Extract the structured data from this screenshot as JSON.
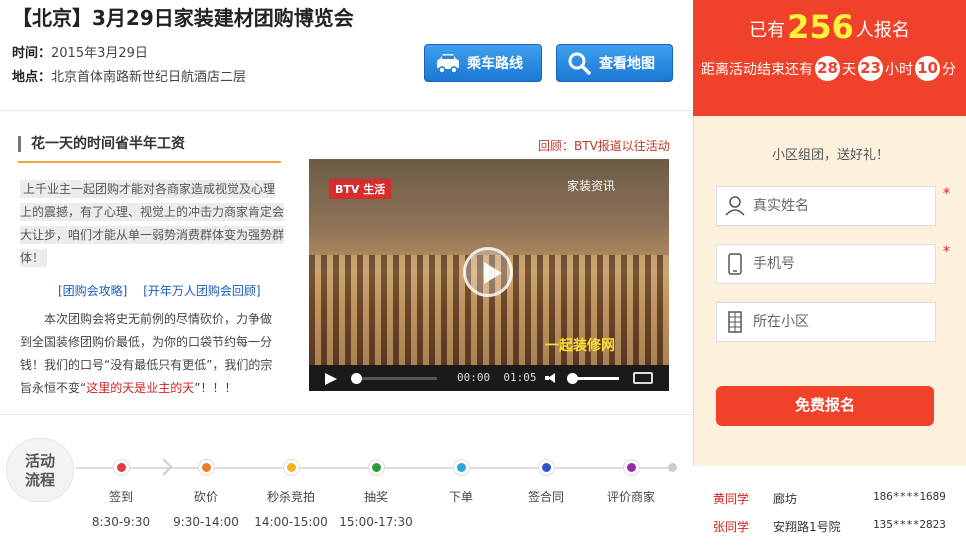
{
  "event": {
    "title": "【北京】3月29日家装建材团购博览会",
    "time_label": "时间：",
    "time_value": "2015年3月29日",
    "addr_label": "地点：",
    "addr_value": "北京首体南路新世纪日航酒店二层"
  },
  "actions": {
    "bus_route": "乘车路线",
    "view_map": "查看地图"
  },
  "intro": {
    "section_title": "花一天的时间省半年工资",
    "review_link": "回顾：BTV报道以往活动",
    "highlight": "上千业主一起团购才能对各商家造成视觉及心理上的震撼，有了心理、视觉上的冲击力商家肯定会大让步，咱们才能从单一弱势消费群体变为强势群体！",
    "link1": "[团购会攻略]",
    "link2": "[开年万人团购会回顾]",
    "body_before": "本次团购会将史无前例的尽情砍价，力争做到全国装修团购价最低，为你的口袋节约每一分钱！我们的口号“没有最低只有更低”，我们的宗旨永恒不变“",
    "body_red": "这里的天是业主的天",
    "body_after": "”！！！"
  },
  "video": {
    "channel_badge": "BTV 生活",
    "channel_text": "家装资讯",
    "banner_text": "一起装修网",
    "time_current": "00:00",
    "time_total": "01:05",
    "progress": 0.0,
    "volume": 1.0
  },
  "process": {
    "badge_line1": "活动",
    "badge_line2": "流程",
    "steps": [
      {
        "name": "签到",
        "time": "8:30-9:30",
        "color": "#e23b3b"
      },
      {
        "name": "砍价",
        "time": "9:30-14:00",
        "color": "#f07c22"
      },
      {
        "name": "秒杀竞拍",
        "time": "14:00-15:00",
        "color": "#f2b51e"
      },
      {
        "name": "抽奖",
        "time": "15:00-17:30",
        "color": "#2a9a3a"
      },
      {
        "name": "下单",
        "time": "",
        "color": "#2aa8d8"
      },
      {
        "name": "签合同",
        "time": "",
        "color": "#2a55c8"
      },
      {
        "name": "评价商家",
        "time": "",
        "color": "#9a2aaa"
      }
    ]
  },
  "registration": {
    "count_prefix": "已有",
    "count": "256",
    "count_suffix": "人报名",
    "countdown_prefix": "距离活动结束还有",
    "days": "28",
    "days_unit": "天",
    "hours": "23",
    "hours_unit": "小时",
    "minutes": "10",
    "minutes_unit": "分",
    "promo": "小区组团，送好礼！",
    "name_placeholder": "真实姓名",
    "phone_placeholder": "手机号",
    "community_placeholder": "所在小区",
    "required_mark": "*",
    "submit": "免费报名"
  },
  "signups": [
    {
      "name": "黄同学",
      "location": "廊坊",
      "phone": "186****1689"
    },
    {
      "name": "张同学",
      "location": "安翔路1号院",
      "phone": "135****2823"
    }
  ],
  "colors": {
    "accent_red": "#f0412a",
    "accent_blue": "#1a78d4",
    "count_yellow": "#fff23a",
    "form_bg": "#fdf0dc"
  }
}
